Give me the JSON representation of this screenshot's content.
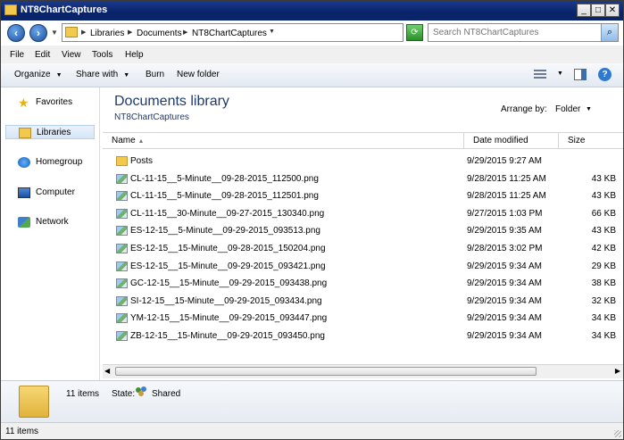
{
  "window": {
    "title": "NT8ChartCaptures",
    "minimize": "_",
    "maximize": "□",
    "close": "✕"
  },
  "address": {
    "crumbs": [
      "Libraries",
      "Documents",
      "NT8ChartCaptures"
    ],
    "search_placeholder": "Search NT8ChartCaptures"
  },
  "menu": [
    "File",
    "Edit",
    "View",
    "Tools",
    "Help"
  ],
  "toolbar": {
    "organize": "Organize",
    "share_with": "Share with",
    "burn": "Burn",
    "new_folder": "New folder"
  },
  "nav": [
    {
      "label": "Favorites",
      "icon": "star-icon"
    },
    {
      "label": "Libraries",
      "icon": "libraries-icon"
    },
    {
      "label": "Homegroup",
      "icon": "homegroup-icon"
    },
    {
      "label": "Computer",
      "icon": "computer-icon"
    },
    {
      "label": "Network",
      "icon": "network-icon"
    }
  ],
  "library": {
    "title": "Documents library",
    "subtitle": "NT8ChartCaptures",
    "arrange_label": "Arrange by:",
    "arrange_value": "Folder"
  },
  "columns": {
    "name": "Name",
    "date": "Date modified",
    "size": "Size"
  },
  "files": [
    {
      "name": "Posts",
      "date": "9/29/2015 9:27 AM",
      "size": "",
      "type": "folder"
    },
    {
      "name": "CL-11-15__5-Minute__09-28-2015_112500.png",
      "date": "9/28/2015 11:25 AM",
      "size": "43 KB",
      "type": "png"
    },
    {
      "name": "CL-11-15__5-Minute__09-28-2015_112501.png",
      "date": "9/28/2015 11:25 AM",
      "size": "43 KB",
      "type": "png"
    },
    {
      "name": "CL-11-15__30-Minute__09-27-2015_130340.png",
      "date": "9/27/2015 1:03 PM",
      "size": "66 KB",
      "type": "png"
    },
    {
      "name": "ES-12-15__5-Minute__09-29-2015_093513.png",
      "date": "9/29/2015 9:35 AM",
      "size": "43 KB",
      "type": "png"
    },
    {
      "name": "ES-12-15__15-Minute__09-28-2015_150204.png",
      "date": "9/28/2015 3:02 PM",
      "size": "42 KB",
      "type": "png"
    },
    {
      "name": "ES-12-15__15-Minute__09-29-2015_093421.png",
      "date": "9/29/2015 9:34 AM",
      "size": "29 KB",
      "type": "png"
    },
    {
      "name": "GC-12-15__15-Minute__09-29-2015_093438.png",
      "date": "9/29/2015 9:34 AM",
      "size": "38 KB",
      "type": "png"
    },
    {
      "name": "SI-12-15__15-Minute__09-29-2015_093434.png",
      "date": "9/29/2015 9:34 AM",
      "size": "32 KB",
      "type": "png"
    },
    {
      "name": "YM-12-15__15-Minute__09-29-2015_093447.png",
      "date": "9/29/2015 9:34 AM",
      "size": "34 KB",
      "type": "png"
    },
    {
      "name": "ZB-12-15__15-Minute__09-29-2015_093450.png",
      "date": "9/29/2015 9:34 AM",
      "size": "34 KB",
      "type": "png"
    }
  ],
  "details": {
    "count": "11 items",
    "state_label": "State:",
    "state_value": "Shared"
  },
  "status": {
    "text": "11 items"
  },
  "colors": {
    "title_bar": "#0a246a",
    "library_title": "#1e3a6e",
    "selection": "#d6e5f6"
  }
}
